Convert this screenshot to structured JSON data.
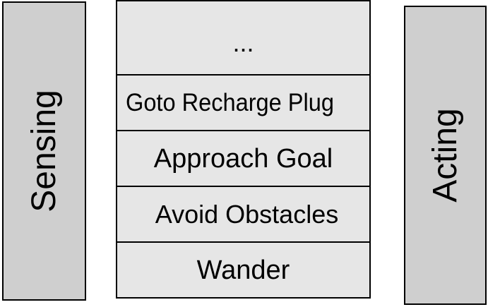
{
  "sensing": {
    "label": "Sensing"
  },
  "acting": {
    "label": "Acting"
  },
  "layers": [
    {
      "label": "..."
    },
    {
      "label": "Goto Recharge Plug"
    },
    {
      "label": "Approach Goal"
    },
    {
      "label": "Avoid Obstacles"
    },
    {
      "label": "Wander"
    }
  ],
  "colors": {
    "side_fill": "#cfcfcf",
    "stack_fill": "#e6e6e6",
    "border": "#000000"
  }
}
